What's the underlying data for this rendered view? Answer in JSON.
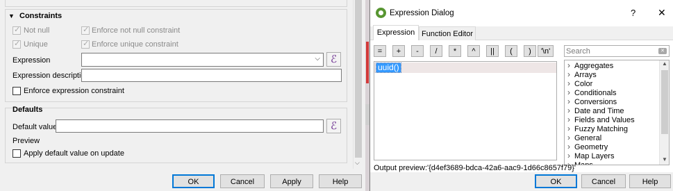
{
  "left": {
    "constraints": {
      "title": "Constraints",
      "not_null": "Not null",
      "enforce_not_null": "Enforce not null constraint",
      "unique": "Unique",
      "enforce_unique": "Enforce unique constraint",
      "expression_label": "Expression",
      "expression_value": "",
      "expression_description_label": "Expression description",
      "expression_description_value": "",
      "enforce_expression": "Enforce expression constraint"
    },
    "defaults": {
      "title": "Defaults",
      "default_value_label": "Default value",
      "default_value": "",
      "preview_label": "Preview",
      "apply_on_update": "Apply default value on update"
    },
    "buttons": {
      "ok": "OK",
      "cancel": "Cancel",
      "apply": "Apply",
      "help": "Help"
    }
  },
  "right": {
    "title": "Expression Dialog",
    "title_buttons": {
      "help": "?",
      "close": "✕"
    },
    "tabs": [
      "Expression",
      "Function Editor"
    ],
    "operators": [
      "=",
      "+",
      "-",
      "/",
      "*",
      "^",
      "||",
      "(",
      ")",
      "'\\n'"
    ],
    "editor_text": "uuid()",
    "search_placeholder": "Search",
    "functions": [
      "Aggregates",
      "Arrays",
      "Color",
      "Conditionals",
      "Conversions",
      "Date and Time",
      "Fields and Values",
      "Fuzzy Matching",
      "General",
      "Geometry",
      "Map Layers",
      "Maps"
    ],
    "output_preview_label": "Output preview:",
    "output_preview_value": "'{d4ef3689-bdca-42a6-aac9-1d66c8657f79}'",
    "buttons": {
      "ok": "OK",
      "cancel": "Cancel",
      "help": "Help"
    }
  },
  "colors": {
    "accent": "#0078d7",
    "selection": "#3399ff",
    "epsilon": "#6a2b8f",
    "qgis_green": "#589632"
  }
}
